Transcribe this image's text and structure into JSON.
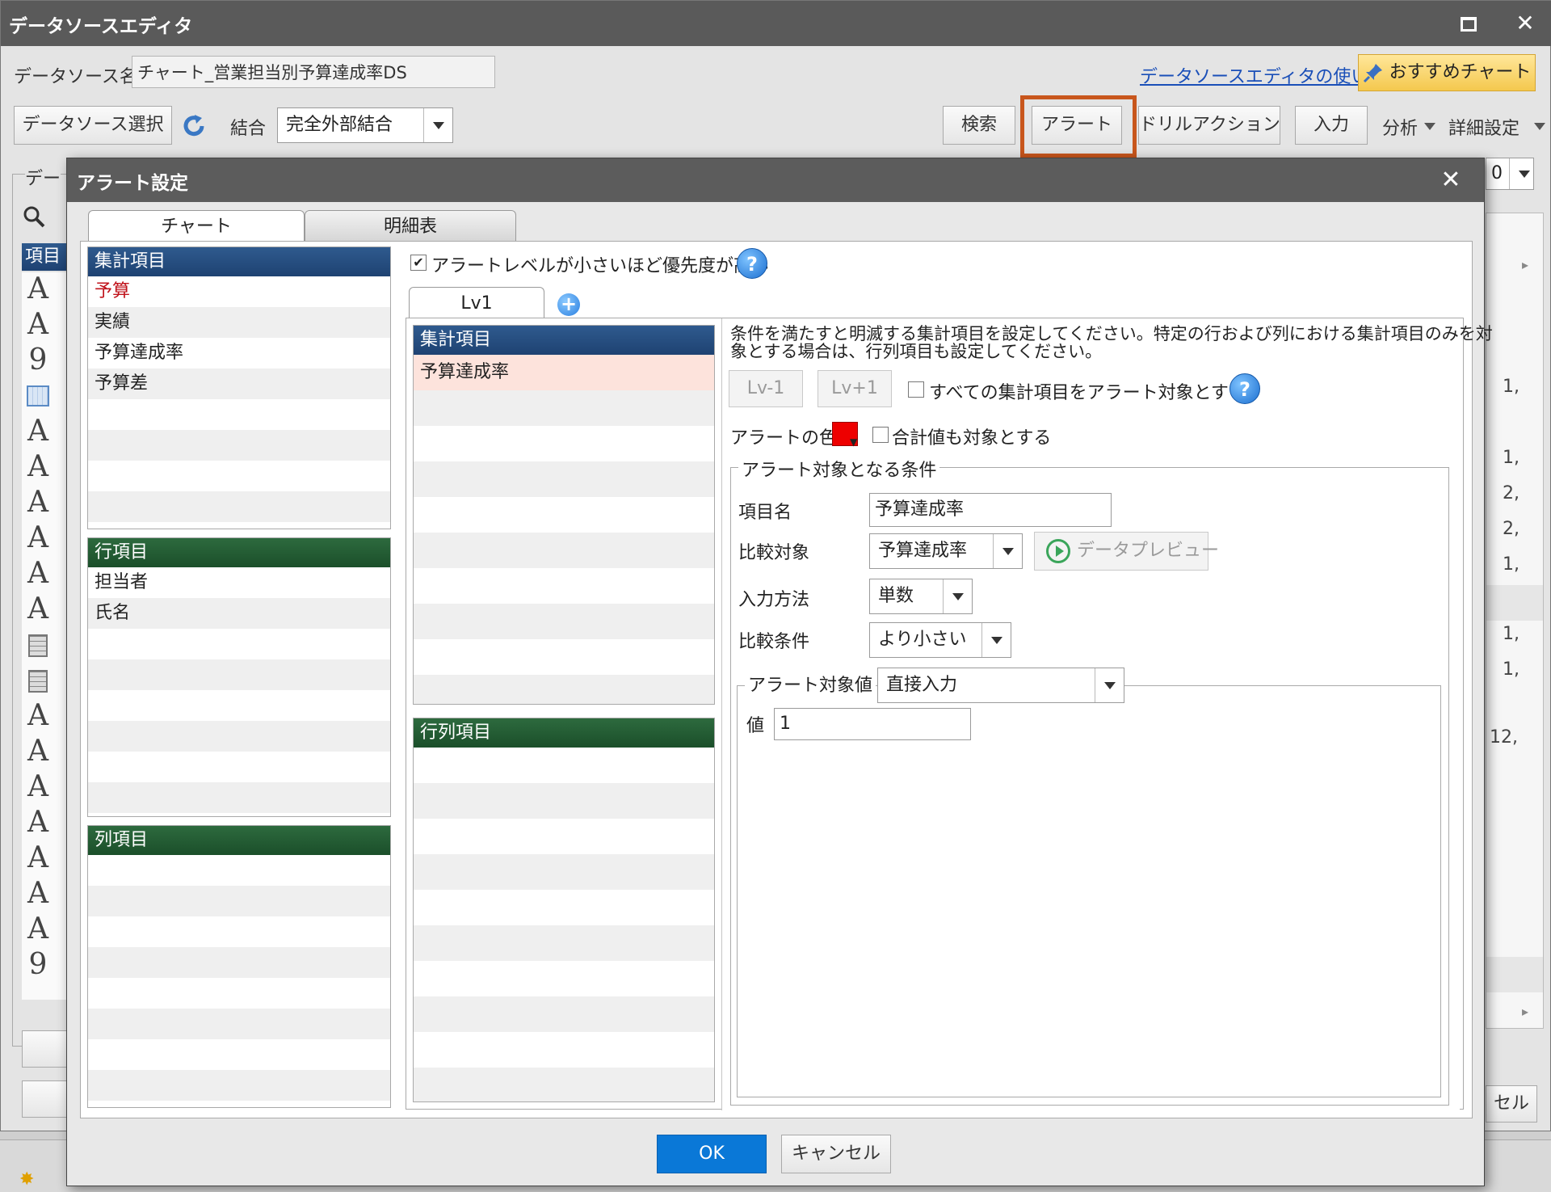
{
  "editor": {
    "title": "データソースエディタ",
    "datasource_name_label": "データソース名",
    "datasource_name_value": "チャート_営業担当別予算達成率DS",
    "help_link": "データソースエディタの使い方",
    "recommend_chart": "おすすめチャート",
    "select_datasource": "データソース選択",
    "join_label": "結合",
    "join_value": "完全外部結合",
    "search": "検索",
    "alert": "アラート",
    "drill_action": "ドリルアクション",
    "input": "入力",
    "analysis": "分析",
    "detail_settings": "詳細設定",
    "data_label_partial": "デー",
    "items_header_partial": "項目",
    "right_values": [
      "1,",
      "1,",
      "2,",
      "2,",
      "1,",
      "1,",
      "1,",
      "12,"
    ],
    "right_zero": "0",
    "cancel_partial": "セル"
  },
  "dialog": {
    "title": "アラート設定",
    "tabs": [
      "チャート",
      "明細表"
    ],
    "aggregate_header": "集計項目",
    "aggregate_items": [
      "予算",
      "実績",
      "予算達成率",
      "予算差"
    ],
    "row_header": "行項目",
    "row_items": [
      "担当者",
      "氏名"
    ],
    "column_header": "列項目",
    "priority_checkbox": "アラートレベルが小さいほど優先度が高い",
    "level_tab": "Lv1",
    "level_aggregate_header": "集計項目",
    "level_aggregate_selected": "予算達成率",
    "rowcol_header": "行列項目",
    "instructions_line1": "条件を満たすと明滅する集計項目を設定してください。特定の行および列における集計項目のみを対",
    "instructions_line2": "象とする場合は、行列項目も設定してください。",
    "lv_minus": "Lv-1",
    "lv_plus": "Lv+1",
    "all_items_checkbox": "すべての集計項目をアラート対象とする",
    "alert_color_label": "アラートの色",
    "alert_color": "#ee0000",
    "include_totals_checkbox": "合計値も対象とする",
    "condition_group": "アラート対象となる条件",
    "item_name_label": "項目名",
    "item_name_value": "予算達成率",
    "compare_target_label": "比較対象",
    "compare_target_value": "予算達成率",
    "data_preview": "データプレビュー",
    "input_method_label": "入力方法",
    "input_method_value": "単数",
    "compare_condition_label": "比較条件",
    "compare_condition_value": "より小さい",
    "alert_value_label": "アラート対象値",
    "alert_value_mode": "直接入力",
    "value_label": "値",
    "value_input": "1",
    "ok": "OK",
    "cancel": "キャンセル"
  },
  "colors": {
    "accent_highlight": "#c8561c",
    "header_blue": "#1e4272",
    "header_green": "#1b4f2a",
    "ok_button": "#0a78d7"
  }
}
